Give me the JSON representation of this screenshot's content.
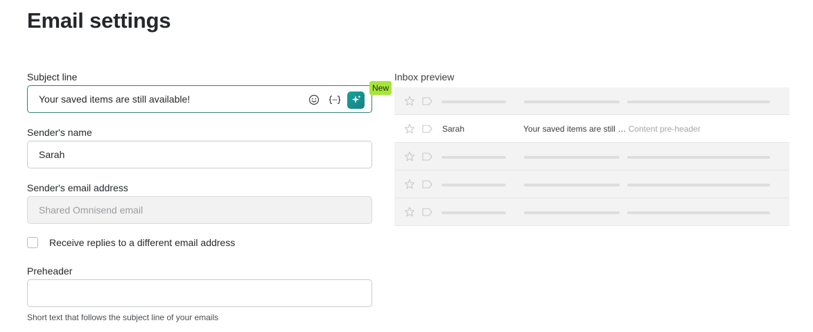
{
  "page": {
    "title": "Email settings"
  },
  "subject": {
    "label": "Subject line",
    "value": "Your saved items are still available!",
    "badge": "New"
  },
  "sender_name": {
    "label": "Sender's name",
    "value": "Sarah"
  },
  "sender_email": {
    "label": "Sender's email address",
    "placeholder": "Shared Omnisend email"
  },
  "reply_option": {
    "label": "Receive replies to a different email address",
    "checked": false
  },
  "preheader": {
    "label": "Preheader",
    "value": "",
    "helper": "Short text that follows the subject line of your emails"
  },
  "inbox_preview": {
    "label": "Inbox preview",
    "email": {
      "sender": "Sarah",
      "subject": "Your saved items are still …",
      "preheader": "Content pre-header"
    }
  },
  "colors": {
    "focus_border": "#2f7f78",
    "ai_button": "#12a39a",
    "new_badge": "#a6e63a"
  },
  "icons": [
    "emoji-icon",
    "personalization-tag-icon",
    "ai-sparkle-icon",
    "star-icon",
    "label-tag-icon"
  ]
}
